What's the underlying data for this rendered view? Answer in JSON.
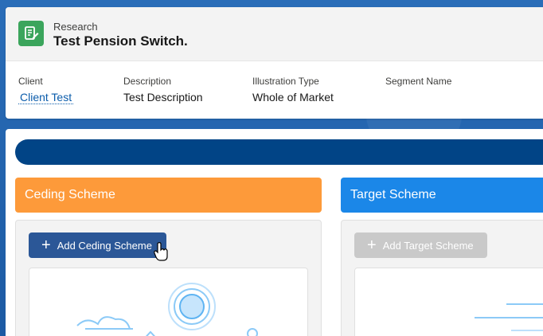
{
  "header": {
    "object_label": "Research",
    "title": "Test Pension Switch.",
    "fields": [
      {
        "label": "Client",
        "value": "Client Test"
      },
      {
        "label": "Description",
        "value": "Test Description"
      },
      {
        "label": "Illustration Type",
        "value": "Whole of Market"
      },
      {
        "label": "Segment Name",
        "value": ""
      }
    ]
  },
  "ceding": {
    "title": "Ceding Scheme",
    "button_label": "Add Ceding Scheme"
  },
  "target": {
    "title": "Target Scheme",
    "button_label": "Add Target Scheme"
  },
  "colors": {
    "ceding_header": "#fd9a3a",
    "target_header": "#1b87e8",
    "progress_bar": "#014486",
    "ceding_button": "#2b5797",
    "target_button_disabled": "#c9c9c9",
    "record_icon": "#3ba55c"
  },
  "icons": {
    "record": "research-document-icon",
    "add": "plus-icon"
  }
}
